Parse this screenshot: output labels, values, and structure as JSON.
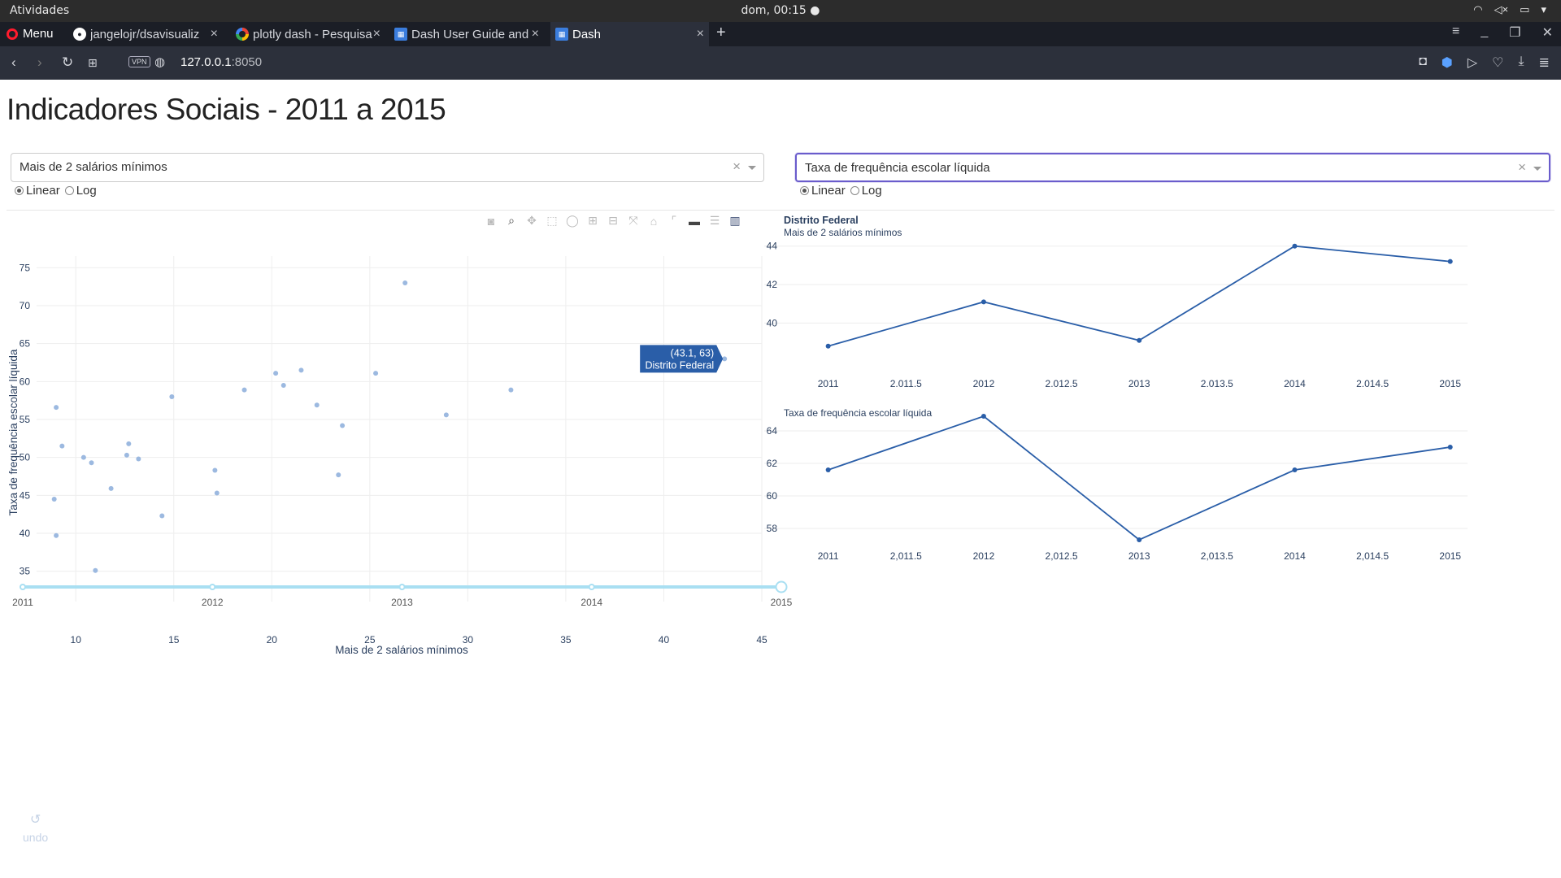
{
  "system_bar": {
    "activities": "Atividades",
    "clock": "dom, 00:15 ●"
  },
  "browser": {
    "menu_label": "Menu",
    "tabs": [
      {
        "title": "jangelojr/dsavisualiz",
        "icon": "github-icon"
      },
      {
        "title": "plotly dash - Pesquisa",
        "icon": "google-icon"
      },
      {
        "title": "Dash User Guide and",
        "icon": "dash-icon"
      },
      {
        "title": "Dash",
        "icon": "dash-icon",
        "active": true
      }
    ],
    "vpn": "VPN",
    "url_host": "127.0.0.1",
    "url_port": ":8050"
  },
  "page": {
    "title": "Indicadores Sociais - 2011 a 2015",
    "left_dropdown": {
      "value": "Mais de 2 salários mínimos",
      "clear": "×"
    },
    "right_dropdown": {
      "value": "Taxa de frequência escolar líquida",
      "clear": "×"
    },
    "scale_options": [
      "Linear",
      "Log"
    ],
    "left_scale_selected": "Linear",
    "right_scale_selected": "Linear"
  },
  "slider": {
    "marks": [
      "2011",
      "2012",
      "2013",
      "2014",
      "2015"
    ],
    "selected": "2015",
    "color": "#a9dff2"
  },
  "undo_label": "undo",
  "chart_data": [
    {
      "type": "scatter",
      "id": "main-scatter",
      "xlabel": "Mais de 2 salários mínimos",
      "ylabel": "Taxa de  frequência escolar líquida",
      "xlim": [
        8,
        45
      ],
      "ylim": [
        34,
        76
      ],
      "xticks": [
        10,
        15,
        20,
        25,
        30,
        35,
        40,
        45
      ],
      "yticks": [
        35,
        40,
        45,
        50,
        55,
        60,
        65,
        70,
        75
      ],
      "grid": true,
      "marker_color": "#9cb9e0",
      "points": [
        {
          "x": 8.9,
          "y": 44.5
        },
        {
          "x": 9.0,
          "y": 56.6
        },
        {
          "x": 9.0,
          "y": 39.7
        },
        {
          "x": 9.3,
          "y": 51.5
        },
        {
          "x": 10.4,
          "y": 50.0
        },
        {
          "x": 10.8,
          "y": 49.3
        },
        {
          "x": 11.0,
          "y": 35.1
        },
        {
          "x": 11.8,
          "y": 45.9
        },
        {
          "x": 12.6,
          "y": 50.3
        },
        {
          "x": 12.7,
          "y": 51.8
        },
        {
          "x": 13.2,
          "y": 49.8
        },
        {
          "x": 14.4,
          "y": 42.3
        },
        {
          "x": 14.9,
          "y": 58.0
        },
        {
          "x": 17.1,
          "y": 48.3
        },
        {
          "x": 17.2,
          "y": 45.3
        },
        {
          "x": 18.6,
          "y": 58.9
        },
        {
          "x": 20.2,
          "y": 61.1
        },
        {
          "x": 20.6,
          "y": 59.5
        },
        {
          "x": 21.5,
          "y": 61.5
        },
        {
          "x": 22.3,
          "y": 56.9
        },
        {
          "x": 23.4,
          "y": 47.7
        },
        {
          "x": 23.6,
          "y": 54.2
        },
        {
          "x": 25.3,
          "y": 61.1
        },
        {
          "x": 26.8,
          "y": 73.0
        },
        {
          "x": 28.9,
          "y": 55.6
        },
        {
          "x": 32.2,
          "y": 58.9
        },
        {
          "x": 43.1,
          "y": 63.0
        }
      ],
      "hover": {
        "point": "(43.1, 63)",
        "label": "Distrito Federal",
        "x": 43.1,
        "y": 63,
        "color": "#2a5ea8"
      }
    },
    {
      "type": "line",
      "id": "ts-top",
      "title": "Distrito Federal",
      "subtitle": "Mais de 2 salários mínimos",
      "x": [
        2011,
        2012,
        2013,
        2014,
        2015
      ],
      "values": [
        38.8,
        41.1,
        39.1,
        44.0,
        43.2
      ],
      "xticks": [
        "2011",
        "2,011.5",
        "2012",
        "2,012.5",
        "2013",
        "2,013.5",
        "2014",
        "2,014.5",
        "2015"
      ],
      "yticks": [
        40,
        42,
        44
      ],
      "ylim": [
        38.2,
        44.2
      ],
      "color": "#2a5ea8"
    },
    {
      "type": "line",
      "id": "ts-bottom",
      "subtitle": "Taxa de  frequência escolar líquida",
      "x": [
        2011,
        2012,
        2013,
        2014,
        2015
      ],
      "values": [
        61.6,
        64.9,
        57.3,
        61.6,
        63.0
      ],
      "xticks": [
        "2011",
        "2,011.5",
        "2012",
        "2,012.5",
        "2013",
        "2,013.5",
        "2014",
        "2,014.5",
        "2015"
      ],
      "yticks": [
        58,
        60,
        62,
        64
      ],
      "ylim": [
        56.8,
        65.4
      ],
      "color": "#2a5ea8"
    }
  ]
}
